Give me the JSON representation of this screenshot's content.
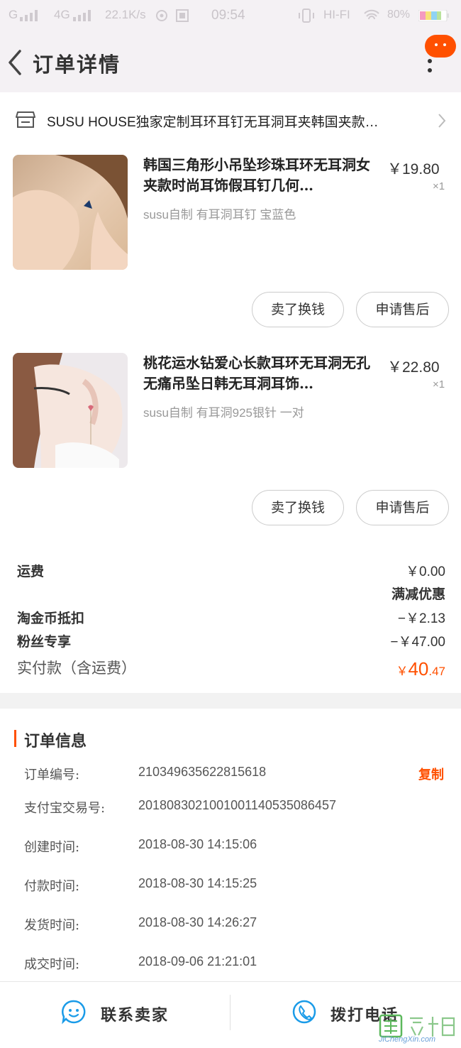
{
  "status_bar": {
    "signal_1": "G",
    "signal_2": "4G",
    "net_speed": "22.1K/s",
    "time": "09:54",
    "hifi": "HI-FI",
    "battery": "80%"
  },
  "nav": {
    "title": "订单详情"
  },
  "shop": {
    "name": "SUSU HOUSE独家定制耳环耳钉无耳洞耳夹韩国夹款…"
  },
  "items": [
    {
      "title": "韩国三角形小吊坠珍珠耳环无耳洞女夹款时尚耳饰假耳钉几何…",
      "price": "￥19.80",
      "qty": "×1",
      "sku": "susu自制 有耳洞耳钉  宝蓝色",
      "btn_sell": "卖了换钱",
      "btn_aftersale": "申请售后"
    },
    {
      "title": "桃花运水钻爱心长款耳环无耳洞无孔无痛吊坠日韩无耳洞耳饰…",
      "price": "￥22.80",
      "qty": "×1",
      "sku": "susu自制 有耳洞925银针 一对",
      "btn_sell": "卖了换钱",
      "btn_aftersale": "申请售后"
    }
  ],
  "fees": {
    "shipping_label": "运费",
    "shipping_value": "￥0.00",
    "discount_title": "满减优惠",
    "taojinbi_label": "淘金币抵扣",
    "taojinbi_value": "−￥2.13",
    "fans_label": "粉丝专享",
    "fans_value": "−￥47.00",
    "actual_label": "实付款（含运费）",
    "actual_currency": "￥",
    "actual_int": "40",
    "actual_dec": ".47"
  },
  "order_info": {
    "title": "订单信息",
    "rows": [
      {
        "k": "订单编号:",
        "v": "210349635622815618"
      },
      {
        "k": "支付宝交易号:",
        "v": "2018083021001001140535086457"
      },
      {
        "k": "创建时间:",
        "v": "2018-08-30 14:15:06"
      },
      {
        "k": "付款时间:",
        "v": "2018-08-30 14:15:25"
      },
      {
        "k": "发货时间:",
        "v": "2018-08-30 14:26:27"
      },
      {
        "k": "成交时间:",
        "v": "2018-09-06 21:21:01"
      }
    ],
    "copy_label": "复制"
  },
  "bottom": {
    "contact_label": "联系卖家",
    "call_label": "拨打电话"
  },
  "watermark": {
    "text": "JiChengXin.com"
  },
  "colors": {
    "accent": "#ff5000",
    "contact_icon": "#1a9be8"
  }
}
